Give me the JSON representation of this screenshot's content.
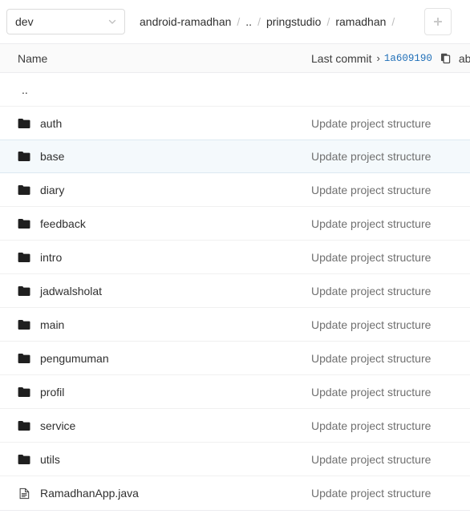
{
  "toolbar": {
    "branch": {
      "value": "dev",
      "chevron_icon": "chevron-down-icon"
    },
    "breadcrumb": {
      "separator": "/",
      "items": [
        "android-ramadhan",
        "..",
        "pringstudio",
        "ramadhan"
      ],
      "trailing_separator": "/"
    },
    "add_button": {
      "icon": "plus-icon",
      "label": "+"
    }
  },
  "table": {
    "headers": {
      "name": "Name",
      "last_commit": "Last commit",
      "caret": "›",
      "sha": "1a609190",
      "copy_icon": "copy-icon",
      "commit_title": "abo"
    },
    "rows": [
      {
        "name": "..",
        "type": "updir",
        "icon": "none",
        "commit": ""
      },
      {
        "name": "auth",
        "type": "folder",
        "icon": "folder-icon",
        "commit": "Update project structure"
      },
      {
        "name": "base",
        "type": "folder",
        "icon": "folder-icon",
        "commit": "Update project structure"
      },
      {
        "name": "diary",
        "type": "folder",
        "icon": "folder-icon",
        "commit": "Update project structure"
      },
      {
        "name": "feedback",
        "type": "folder",
        "icon": "folder-icon",
        "commit": "Update project structure"
      },
      {
        "name": "intro",
        "type": "folder",
        "icon": "folder-icon",
        "commit": "Update project structure"
      },
      {
        "name": "jadwalsholat",
        "type": "folder",
        "icon": "folder-icon",
        "commit": "Update project structure"
      },
      {
        "name": "main",
        "type": "folder",
        "icon": "folder-icon",
        "commit": "Update project structure"
      },
      {
        "name": "pengumuman",
        "type": "folder",
        "icon": "folder-icon",
        "commit": "Update project structure"
      },
      {
        "name": "profil",
        "type": "folder",
        "icon": "folder-icon",
        "commit": "Update project structure"
      },
      {
        "name": "service",
        "type": "folder",
        "icon": "folder-icon",
        "commit": "Update project structure"
      },
      {
        "name": "utils",
        "type": "folder",
        "icon": "folder-icon",
        "commit": "Update project structure"
      },
      {
        "name": "RamadhanApp.java",
        "type": "file",
        "icon": "file-icon",
        "commit": "Update project structure"
      }
    ],
    "selected_row_index": 2
  },
  "colors": {
    "link": "#1f6fb8",
    "selected_row_bg": "#f4f9fc",
    "header_bg": "#fafafa",
    "muted_text": "#707070"
  }
}
